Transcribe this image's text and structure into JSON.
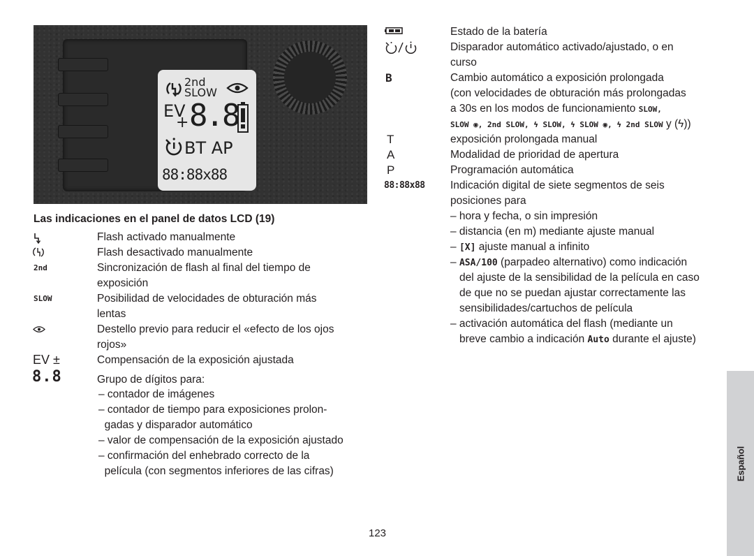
{
  "lcd_image": {
    "line1_top": "2nd",
    "line1_bottom": "SLOW",
    "ev_label": "EV",
    "plus_minus": "+",
    "digits": "8.8",
    "mode_letters": "BT AP",
    "seven_segment": "88:88x88",
    "icons": [
      "flash-off-icon",
      "eye-icon",
      "battery-icon",
      "self-timer-icon"
    ]
  },
  "left_section": {
    "heading": "Las indicaciones en el panel de datos LCD (19)",
    "items": [
      {
        "symbol": "ϟ",
        "symbol_name": "flash-icon",
        "lines": [
          "Flash activado manualmente"
        ]
      },
      {
        "symbol": "⟲ϟ",
        "symbol_name": "flash-off-icon",
        "lines": [
          "Flash desactivado manualmente"
        ]
      },
      {
        "symbol": "2nd",
        "symbol_name": "2nd-label",
        "lines": [
          "Sincronización de flash al final del tiempo de",
          "exposición"
        ]
      },
      {
        "symbol": "SLOW",
        "symbol_name": "slow-label",
        "lines": [
          "Posibilidad de velocidades de obturación más",
          "lentas"
        ]
      },
      {
        "symbol": "◉",
        "symbol_name": "eye-icon",
        "lines": [
          "Destello previo para reducir el «efecto de los ojos",
          "rojos»"
        ]
      },
      {
        "symbol": "EV ±",
        "symbol_name": "ev-label",
        "lines": [
          "Compensación de la exposición ajustada"
        ]
      },
      {
        "symbol": "8.8",
        "symbol_name": "digits-label",
        "lines": [
          "Grupo de dígitos para:"
        ]
      }
    ],
    "digit_list": [
      [
        "– contador de imágenes"
      ],
      [
        "– contador de tiempo para exposiciones prolon-",
        "  gadas y disparador automático"
      ],
      [
        "– valor de compensación de la exposición ajustado"
      ],
      [
        "– confirmación del enhebrado correcto de la",
        "  película (con segmentos inferiores de las cifras)"
      ]
    ]
  },
  "right_section": {
    "battery": {
      "symbol_name": "battery-icon",
      "text": "Estado de la batería"
    },
    "self_timer": {
      "symbol": "◌/◌",
      "symbol_name": "self-timer-icon",
      "lines": [
        "Disparador automático activado/ajustado, o en",
        "curso"
      ]
    },
    "b": {
      "symbol": "B",
      "lines": [
        "Cambio automático a exposición prolongada",
        "(con velocidades de obturación más prolongadas"
      ],
      "line3_text": "a 30s en los modos de funcionamiento ",
      "line3_sc": "SLOW,",
      "line4": {
        "p1": "SLOW ◉, 2nd SLOW, ϟ SLOW, ϟ SLOW ◉, ϟ 2nd SLOW",
        "p2": " y ",
        "p3": "(ϟ))"
      }
    },
    "t": {
      "symbol": "T",
      "text": "exposición prolongada manual"
    },
    "a": {
      "symbol": "A",
      "text": "Modalidad de prioridad de apertura"
    },
    "p": {
      "symbol": "P",
      "text": "Programación automática"
    },
    "seg": {
      "symbol": "88:88x88",
      "lines": [
        "Indicación digital de siete segmentos de seis",
        "posiciones para"
      ],
      "sub1": "– hora y fecha, o sin impresión",
      "sub2": "– distancia (en m) mediante ajuste manual",
      "sub3_pre": "– ",
      "sub3_seg": "[X]",
      "sub3_text": " ajuste manual a infinito",
      "sub4_pre": "– ",
      "sub4_seg": "ASA/100",
      "sub4_text": " (parpadeo alternativo) como indicación",
      "sub4_cont": [
        "del ajuste de la sensibilidad de la película en caso",
        "de que no se puedan ajustar correctamente las",
        "sensibilidades/cartuchos de película"
      ],
      "sub5": "– activación automática del flash (mediante un",
      "sub5_cont_pre": "breve cambio a indicación ",
      "sub5_seg": "Auto",
      "sub5_cont_post": " durante el ajuste)"
    }
  },
  "side_tab": "Español",
  "page_number": "123"
}
